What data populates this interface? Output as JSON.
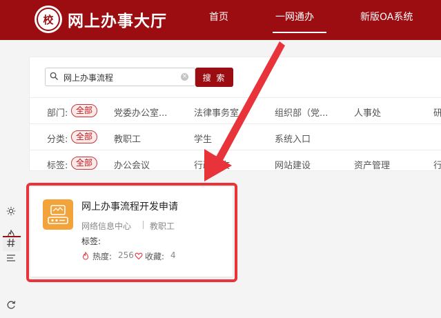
{
  "header": {
    "title": "网上办事大厅",
    "logo_text": "校",
    "nav": [
      {
        "label": "首页"
      },
      {
        "label": "一网通办"
      },
      {
        "label": "新版OA系统"
      }
    ]
  },
  "search": {
    "value": "网上办事流程",
    "button_label": "搜 索"
  },
  "filters": {
    "department": {
      "label": "部门:",
      "all": "全部",
      "options": [
        "党委办公室...",
        "法律事务室",
        "组织部（党...",
        "人事处",
        "研"
      ]
    },
    "category": {
      "label": "分类:",
      "all": "全部",
      "options": [
        "教职工",
        "学生",
        "系统入口"
      ]
    },
    "tag": {
      "label": "标签:",
      "all": "全部",
      "options": [
        "办公会议",
        "行政发文",
        "网站建设",
        "资产管理",
        "行"
      ]
    }
  },
  "result": {
    "title": "网上办事流程开发申请",
    "department": "网络信息中心",
    "category": "教职工",
    "tags_label": "标签:",
    "heat_label": "热度:",
    "heat_value": "256",
    "fav_label": "收藏:",
    "fav_value": "4"
  },
  "sidebar_icons": [
    "sun-icon",
    "flame-icon",
    "list-icon",
    "hash-icon",
    "refresh-icon"
  ],
  "colors": {
    "brand": "#9c0d12",
    "annotation": "#e8333a",
    "card_icon": "#f2a33a"
  }
}
